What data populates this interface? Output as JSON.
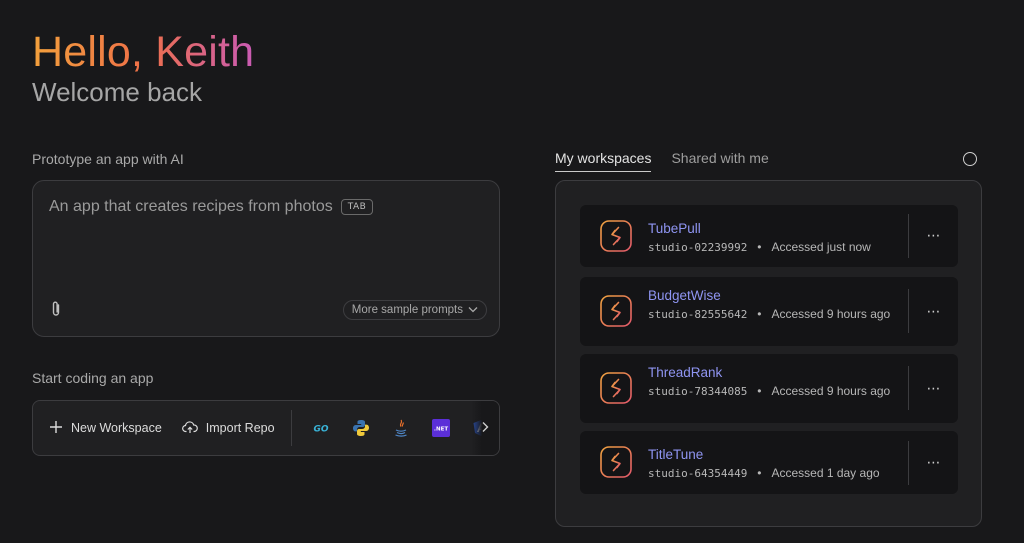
{
  "greeting": {
    "hello": "Hello, Keith",
    "welcome": "Welcome back"
  },
  "prototype": {
    "label": "Prototype an app with AI",
    "prompt_text": "An app that creates recipes from photos",
    "tab_hint": "TAB",
    "attach_icon": "paperclip-icon",
    "sample_prompts_label": "More sample prompts"
  },
  "coding": {
    "label": "Start coding an app",
    "new_workspace_label": "New Workspace",
    "import_repo_label": "Import Repo",
    "languages": [
      {
        "icon": "go-icon",
        "text": "GO"
      },
      {
        "icon": "python-icon"
      },
      {
        "icon": "java-icon"
      },
      {
        "icon": "dotnet-icon",
        "text": ".NET"
      },
      {
        "icon": "angular-icon"
      }
    ]
  },
  "workspaces": {
    "tabs": [
      "My workspaces",
      "Shared with me"
    ],
    "active_tab": "My workspaces",
    "items": [
      {
        "name": "TubePull",
        "id": "studio-02239992",
        "accessed": "Accessed just now"
      },
      {
        "name": "BudgetWise",
        "id": "studio-82555642",
        "accessed": "Accessed 9 hours ago"
      },
      {
        "name": "ThreadRank",
        "id": "studio-78344085",
        "accessed": "Accessed 9 hours ago"
      },
      {
        "name": "TitleTune",
        "id": "studio-64354449",
        "accessed": "Accessed 1 day ago"
      }
    ],
    "more_label": "⋯"
  },
  "colors": {
    "background": "#18181a",
    "panel": "#202022",
    "card": "#141416",
    "accent_name": "#8f95f2",
    "greeting_gradient": [
      "#f2a03c",
      "#ef7048",
      "#c95bb4"
    ]
  }
}
